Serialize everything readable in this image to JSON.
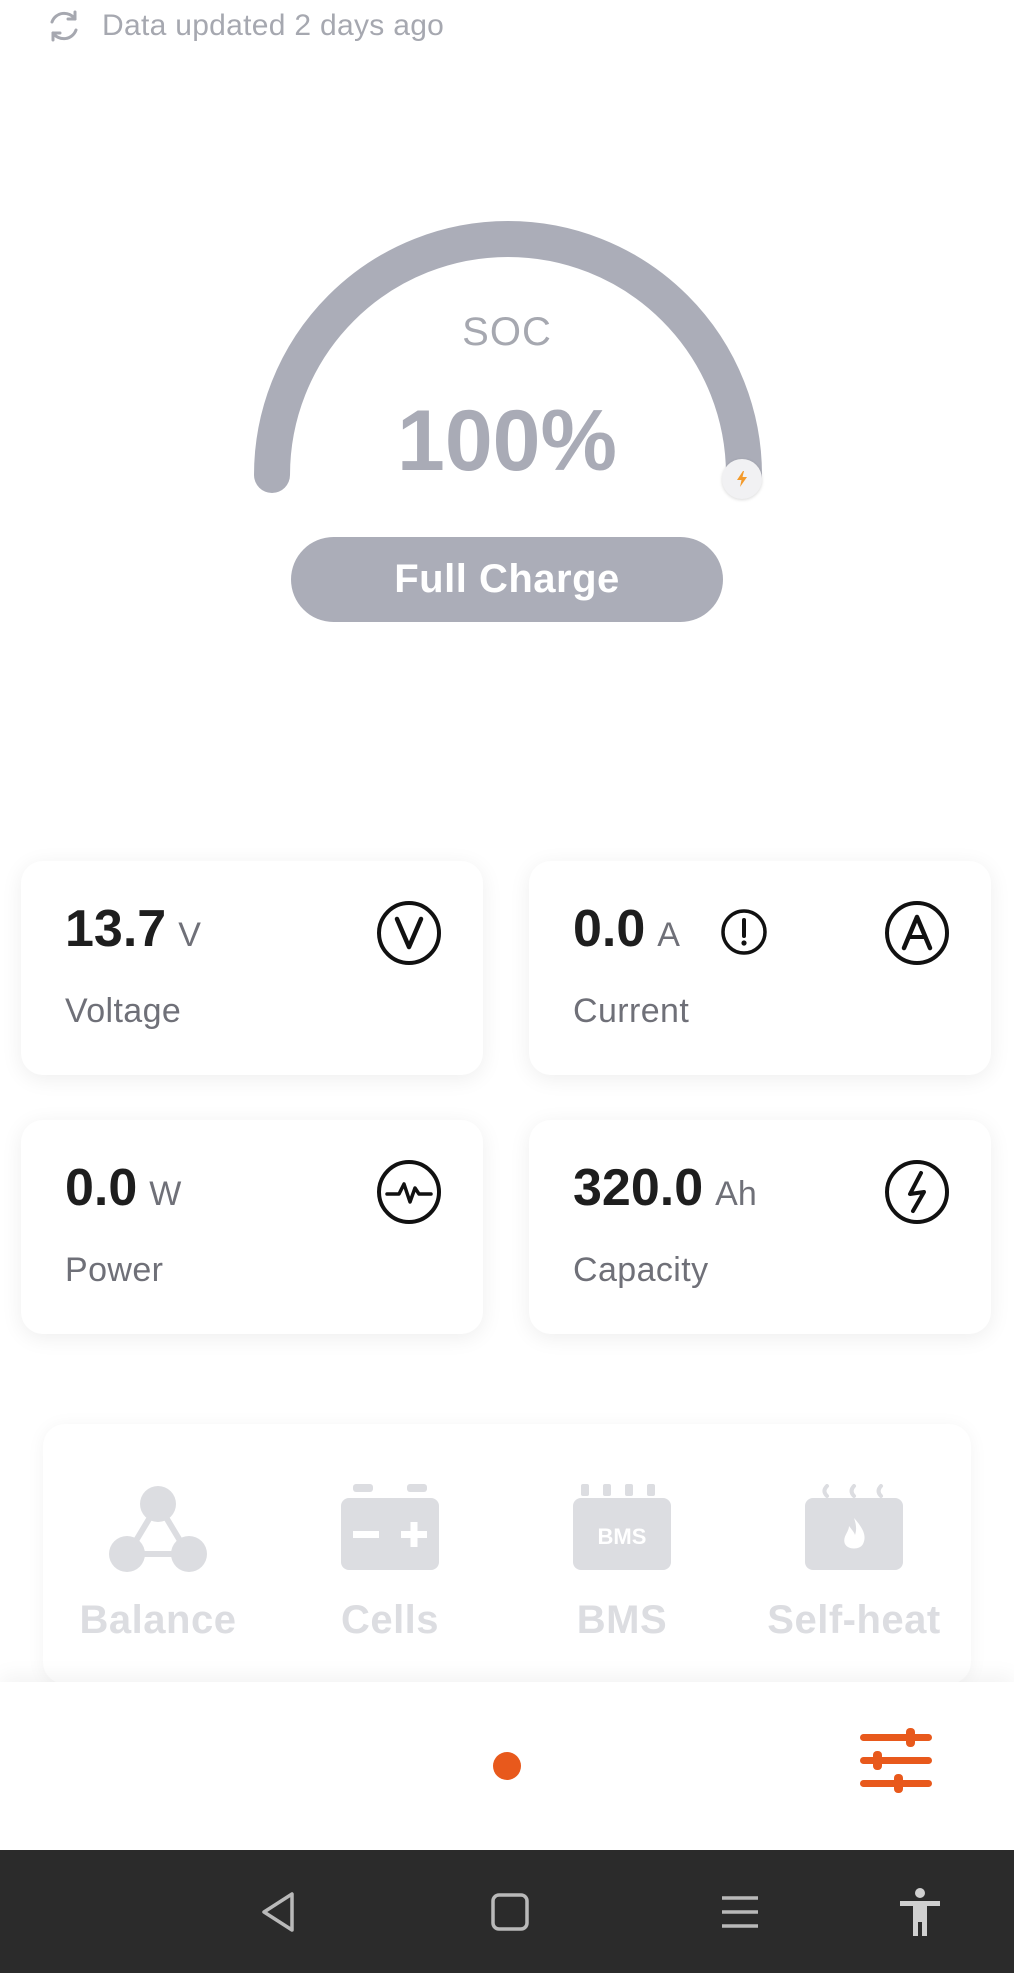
{
  "status": {
    "updated_text": "Data updated 2 days ago",
    "refresh_icon": "refresh-icon"
  },
  "gauge": {
    "label": "SOC",
    "value": "100%",
    "level": 1.0,
    "charging_icon": "lightning-icon",
    "status_label": "Full Charge",
    "colors": {
      "track": "#abadb8",
      "accent": "#f39a2b"
    }
  },
  "metrics": [
    {
      "value": "13.7",
      "unit": "V",
      "label": "Voltage",
      "icon": "voltage-icon"
    },
    {
      "value": "0.0",
      "unit": "A",
      "label": "Current",
      "icon": "ampere-icon",
      "alert_icon": "alert-circle-icon"
    },
    {
      "value": "0.0",
      "unit": "W",
      "label": "Power",
      "icon": "pulse-icon"
    },
    {
      "value": "320.0",
      "unit": "Ah",
      "label": "Capacity",
      "icon": "bolt-icon"
    }
  ],
  "tools": [
    {
      "label": "Balance",
      "icon": "balance-icon"
    },
    {
      "label": "Cells",
      "icon": "battery-cells-icon"
    },
    {
      "label": "BMS",
      "icon": "bms-icon",
      "icon_text": "BMS"
    },
    {
      "label": "Self-heat",
      "icon": "self-heat-icon"
    }
  ],
  "appbar": {
    "indicator_color": "#e8591c",
    "settings_icon": "settings-sliders-icon"
  },
  "system_nav": {
    "buttons": [
      "back-icon",
      "home-icon",
      "recents-icon",
      "accessibility-icon"
    ]
  }
}
